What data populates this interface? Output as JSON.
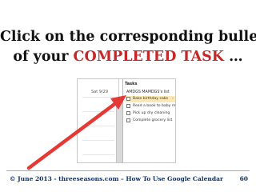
{
  "slide": {
    "headline_line1": "Click on the corresponding bullet",
    "headline_line2_prefix": "of  your ",
    "headline_line2_highlight": "COMPLETED TASK",
    "headline_line2_suffix": " …",
    "highlight_color": "#c62828"
  },
  "screenshot": {
    "calendar_date": "Sat 9/29",
    "tasks_title": "Tasks",
    "list_name": "AMDGS MAMDGS's list",
    "tasks": [
      {
        "label": "Bake birthday cake",
        "active": true,
        "arrow": "›"
      },
      {
        "label": "Read a book to baby m",
        "active": false,
        "arrow": ""
      },
      {
        "label": "Pick up dry cleaning",
        "active": false,
        "arrow": ""
      },
      {
        "label": "Complete grocery list",
        "active": false,
        "arrow": ""
      }
    ]
  },
  "footer": {
    "text": "© June 2013  - threeseasons.com – How To Use Google Calendar",
    "page": "60",
    "color": "#0d2f6e"
  },
  "annotation": {
    "arrow_color": "#e53935",
    "arrow_icon": "red-pointer-arrow"
  }
}
